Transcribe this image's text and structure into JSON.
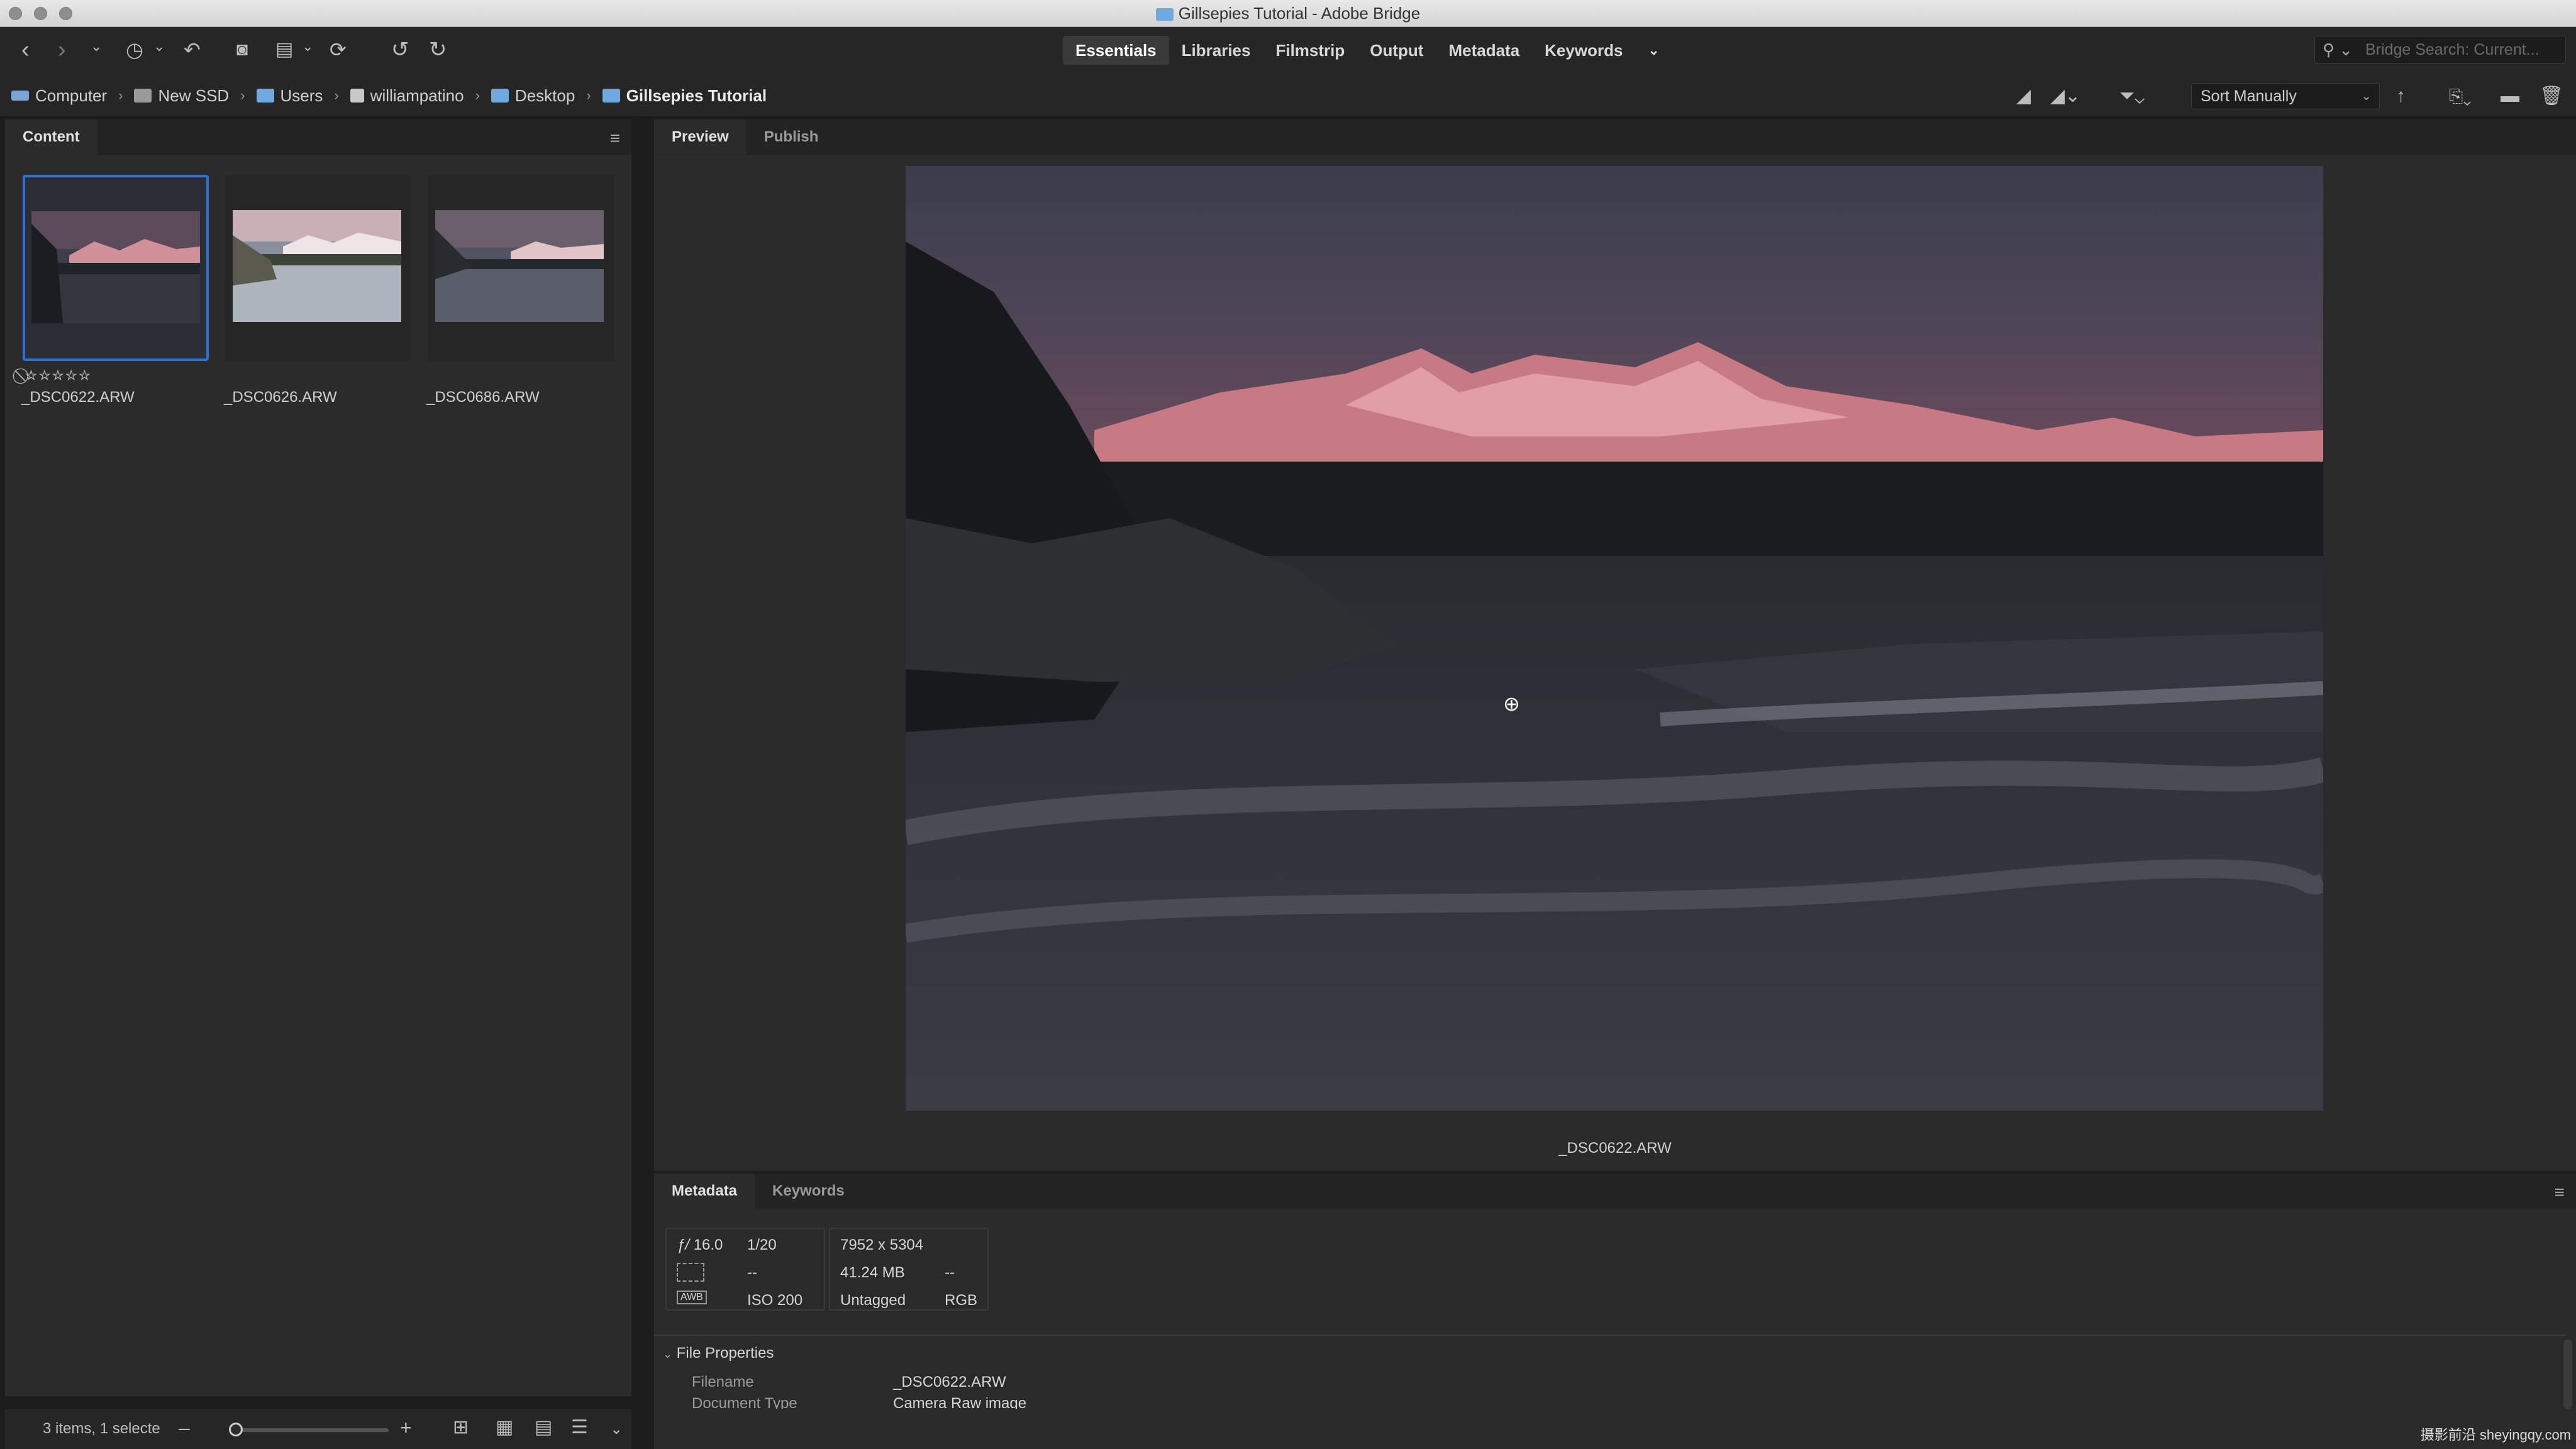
{
  "window": {
    "title": "Gillsepies Tutorial - Adobe Bridge"
  },
  "workspaces": [
    "Essentials",
    "Libraries",
    "Filmstrip",
    "Output",
    "Metadata",
    "Keywords"
  ],
  "active_workspace": "Essentials",
  "search": {
    "placeholder": "Bridge Search: Current..."
  },
  "breadcrumbs": [
    "Computer",
    "New SSD",
    "Users",
    "williampatino",
    "Desktop",
    "Gillsepies Tutorial"
  ],
  "sort": {
    "selected": "Sort Manually"
  },
  "content_panel": {
    "tab": "Content",
    "items": [
      {
        "filename": "_DSC0622.ARW",
        "selected": true,
        "rating": 0
      },
      {
        "filename": "_DSC0626.ARW",
        "selected": false
      },
      {
        "filename": "_DSC0686.ARW",
        "selected": false
      }
    ],
    "status": "3 items, 1 selecte"
  },
  "preview_panel": {
    "tabs": [
      "Preview",
      "Publish"
    ],
    "caption": "_DSC0622.ARW"
  },
  "metadata_panel": {
    "tabs": [
      "Metadata",
      "Keywords"
    ],
    "aperture": "16.0",
    "shutter": "1/20",
    "dash1": "--",
    "iso": "ISO 200",
    "dimensions": "7952 x 5304",
    "size": "41.24 MB",
    "dash2": "--",
    "profile": "Untagged",
    "color_mode": "RGB",
    "section": "File Properties",
    "fields": [
      {
        "label": "Filename",
        "value": "_DSC0622.ARW"
      },
      {
        "label": "Document Type",
        "value": "Camera Raw image"
      }
    ]
  },
  "watermark": "摄影前沿 sheyingqy.com",
  "colors": {
    "accent": "#2f6fd7",
    "folder": "#6fa9e0"
  }
}
